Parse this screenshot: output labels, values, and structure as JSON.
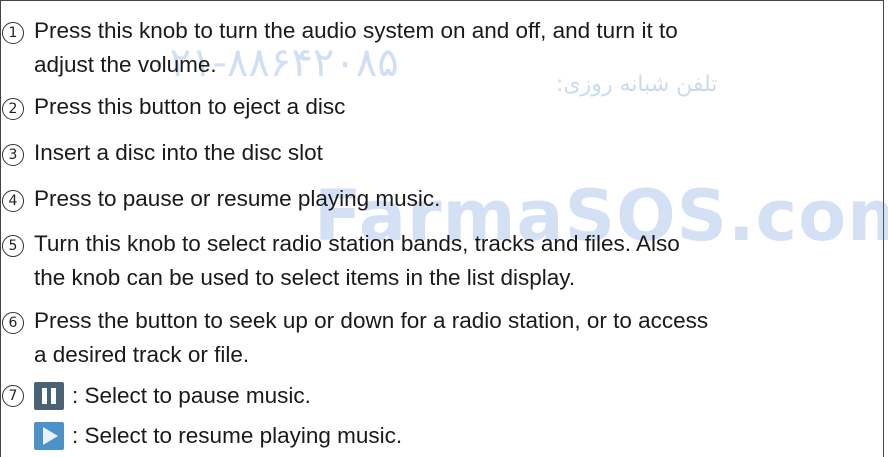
{
  "watermark": {
    "phone": "۰۲۱-۸۸۶۴۲۰۸۵",
    "phone_label": "تلفن شبانه روزی:",
    "site": "FarmaSOS.com"
  },
  "items": [
    {
      "number": "1",
      "lines": [
        "Press this knob to turn the audio system on and off, and turn it to",
        "adjust the volume."
      ]
    },
    {
      "number": "2",
      "lines": [
        "Press this button to eject a disc"
      ]
    },
    {
      "number": "3",
      "lines": [
        "Insert a disc into the disc slot"
      ]
    },
    {
      "number": "4",
      "lines": [
        "Press to pause or resume playing music."
      ]
    },
    {
      "number": "5",
      "lines": [
        "Turn this knob to select radio station bands, tracks and files. Also",
        "the knob can be used to select items in the list display."
      ]
    },
    {
      "number": "6",
      "lines": [
        "Press the button to seek up or down for a radio station, or to access",
        "a desired track or file."
      ]
    },
    {
      "number": "7",
      "icon_rows": [
        {
          "icon": "pause-icon",
          "text": ": Select to pause music."
        },
        {
          "icon": "play-icon",
          "text": ": Select to resume playing music."
        }
      ]
    }
  ]
}
